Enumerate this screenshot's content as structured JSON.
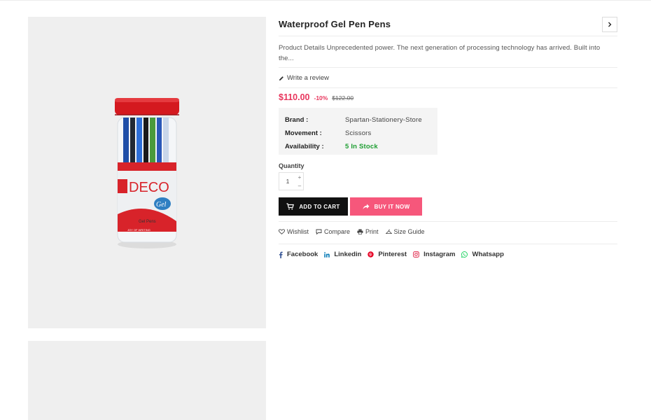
{
  "product": {
    "title": "Waterproof Gel Pen Pens",
    "description": "Product Details Unprecedented power. The next generation of processing technology has arrived. Built into the...",
    "review_label": "Write a review",
    "price": "$110.00",
    "discount": "-10%",
    "old_price": "$122.00",
    "image": {
      "brand_text": "DECO",
      "sub_brand": "Gel",
      "label_text": "Gel Pens",
      "band_text": "JOY OF WRITING"
    }
  },
  "specs": [
    {
      "key": "Brand :",
      "value": "Spartan-Stationery-Store"
    },
    {
      "key": "Movement :",
      "value": "Scissors"
    },
    {
      "key": "Availability :",
      "value": "5 In Stock"
    }
  ],
  "quantity": {
    "label": "Quantity",
    "value": "1",
    "plus": "+",
    "minus": "–"
  },
  "buttons": {
    "add_to_cart": "ADD TO CART",
    "buy_now": "BUY IT NOW"
  },
  "actions": [
    "Wishlist",
    "Compare",
    "Print",
    "Size Guide"
  ],
  "socials": [
    {
      "label": "Facebook",
      "color": "#3b5998"
    },
    {
      "label": "Linkedin",
      "color": "#0077b5"
    },
    {
      "label": "Pinterest",
      "color": "#e60023"
    },
    {
      "label": "Instagram",
      "color": "#e4405f"
    },
    {
      "label": "Whatsapp",
      "color": "#25d366"
    }
  ],
  "colors": {
    "accent_pink": "#f6577b",
    "price_red": "#e8365d",
    "stock_green": "#1e9e32",
    "cart_black": "#111111"
  }
}
